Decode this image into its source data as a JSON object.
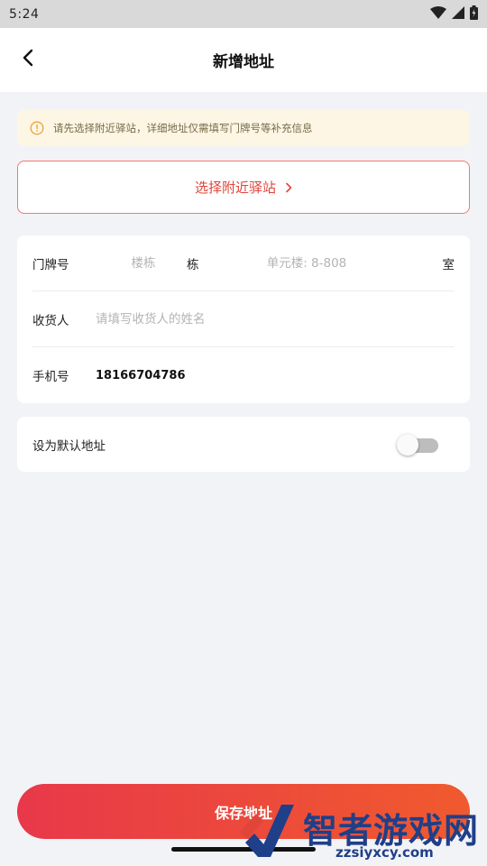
{
  "status_bar": {
    "time": "5:24",
    "icons": [
      "wifi-icon",
      "signal-icon",
      "battery-icon"
    ]
  },
  "header": {
    "title": "新增地址",
    "back_icon": "chevron-left-icon"
  },
  "notice": {
    "icon": "info-icon",
    "text": "请先选择附近驿站，详细地址仅需填写门牌号等补充信息"
  },
  "station_button": {
    "label": "选择附近驿站",
    "icon": "chevron-right-icon"
  },
  "form": {
    "door": {
      "label": "门牌号",
      "building_placeholder": "楼栋",
      "building_value": "",
      "building_unit": "栋",
      "room_placeholder": "单元楼: 8-808",
      "room_value": "",
      "room_unit": "室"
    },
    "name": {
      "label": "收货人",
      "placeholder": "请填写收货人的姓名",
      "value": ""
    },
    "phone": {
      "label": "手机号",
      "value": "18166704786"
    }
  },
  "default_address": {
    "label": "设为默认地址",
    "enabled": false
  },
  "save_button": {
    "label": "保存地址"
  },
  "watermark": {
    "text": "智者游戏网",
    "url": "zzsiyxcy.com"
  },
  "colors": {
    "accent": "#e0453a",
    "notice_bg": "#fdf6e4",
    "notice_icon": "#e8a53a",
    "background": "#f2f3f6",
    "save_gradient_start": "#e8384a",
    "save_gradient_end": "#f05a2e"
  }
}
